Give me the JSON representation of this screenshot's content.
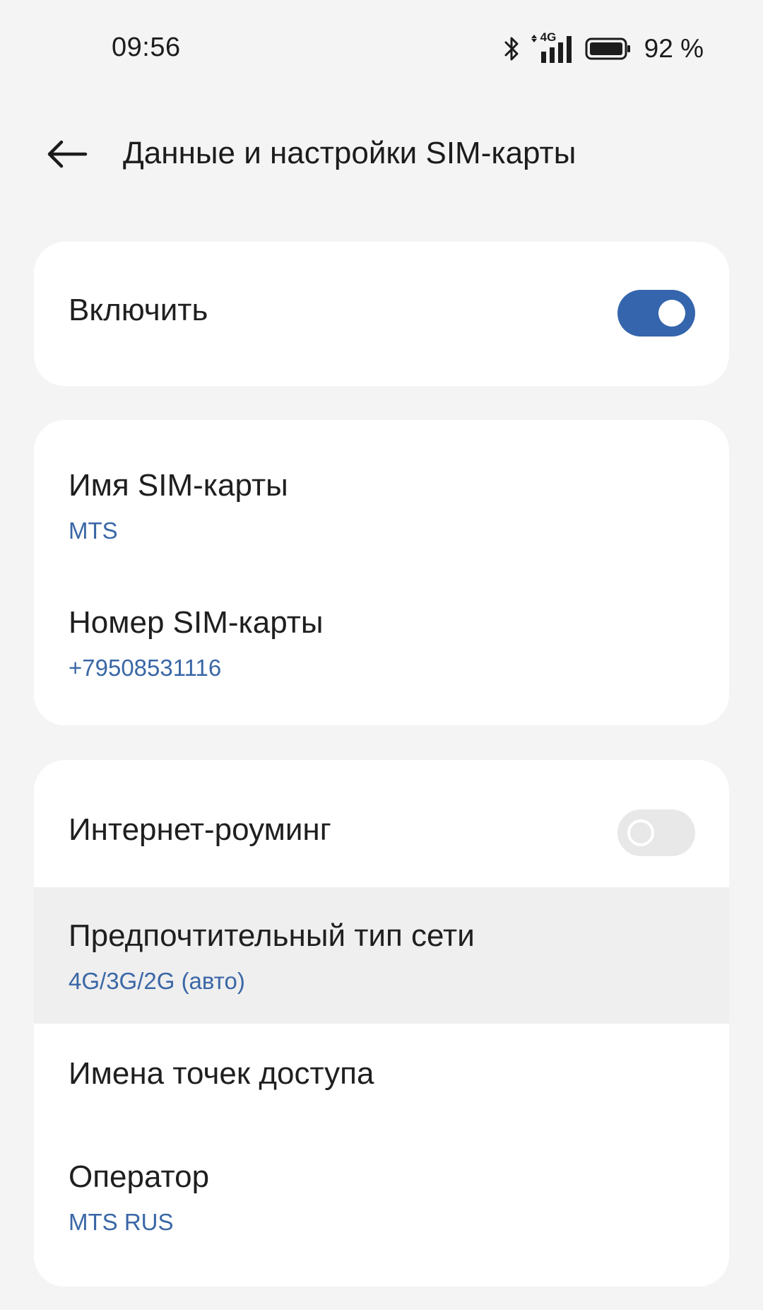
{
  "status_bar": {
    "time": "09:56",
    "network_type": "4G",
    "battery_percent": "92 %",
    "icons": [
      "bluetooth-icon",
      "signal-4g-icon",
      "battery-icon"
    ]
  },
  "header": {
    "back_icon": "arrow-left-icon",
    "title": "Данные и настройки SIM-карты"
  },
  "enable_card": {
    "label": "Включить",
    "toggle_state": "on"
  },
  "sim_card": {
    "name_label": "Имя SIM-карты",
    "name_value": "MTS",
    "number_label": "Номер SIM-карты",
    "number_value": "+79508531116"
  },
  "network_card": {
    "roaming_label": "Интернет-роуминг",
    "roaming_toggle_state": "off",
    "network_type_label": "Предпочтительный тип сети",
    "network_type_value": "4G/3G/2G (авто)",
    "apn_label": "Имена точек доступа",
    "operator_label": "Оператор",
    "operator_value": "MTS RUS"
  },
  "colors": {
    "accent": "#3565ad",
    "subtext": "#3a67a6",
    "background": "#f4f4f4",
    "card": "#ffffff",
    "highlight_row": "#efefef"
  }
}
